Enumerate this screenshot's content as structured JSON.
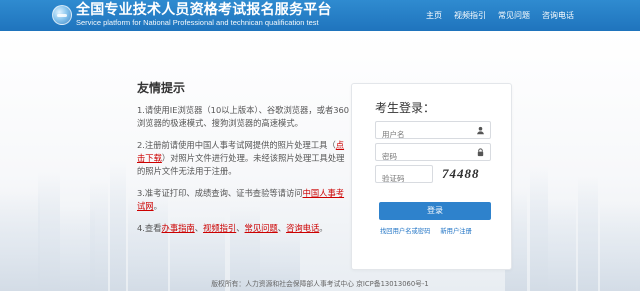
{
  "header": {
    "title": "全国专业技术人员资格考试报名服务平台",
    "subtitle": "Service platform for National Professional and technican qualification test",
    "nav": [
      "主页",
      "视频指引",
      "常见问题",
      "咨询电话"
    ]
  },
  "tips": {
    "title": "友情提示",
    "items": [
      {
        "text": "1.请使用IE浏览器（10以上版本）、谷歌浏览器，或者360浏览器的极速模式、搜狗浏览器的高速模式。"
      },
      {
        "pre": "2.注册前请使用中国人事考试网提供的照片处理工具（",
        "link": "点击下载",
        "post": "）对照片文件进行处理。未经该照片处理工具处理的照片文件无法用于注册。"
      },
      {
        "pre": "3.准考证打印、成绩查询、证书查验等请访问",
        "link": "中国人事考试网",
        "post": "。"
      },
      {
        "pre": "4.查看",
        "links": [
          "办事指南",
          "视频指引",
          "常见问题",
          "咨询电话"
        ],
        "sep": "、",
        "post": "。"
      }
    ]
  },
  "login": {
    "title": "考生登录：",
    "username_placeholder": "用户名",
    "password_placeholder": "密码",
    "captcha_placeholder": "验证码",
    "captcha_text": "74488",
    "submit_label": "登录",
    "forgot_label": "找回用户名或密码",
    "register_label": "新用户注册"
  },
  "footer": {
    "text": "版权所有：人力资源和社会保障部人事考试中心 京ICP备13013060号-1"
  },
  "colors": {
    "header": "#2f8bd0",
    "button": "#2e82cc",
    "link": "#1f73c5",
    "alert": "#cc0000"
  }
}
